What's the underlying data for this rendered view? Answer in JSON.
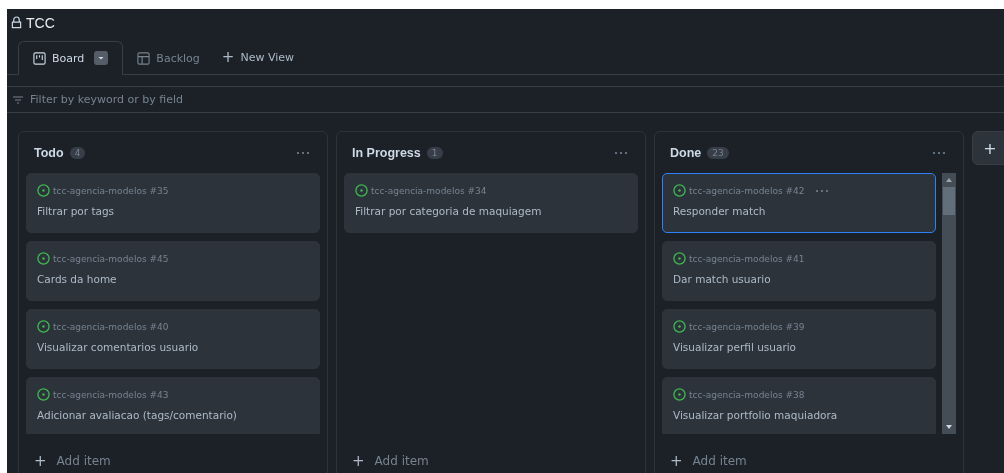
{
  "project": {
    "title": "TCC"
  },
  "views": [
    {
      "label": "Board",
      "kind": "board",
      "selected": true
    },
    {
      "label": "Backlog",
      "kind": "table",
      "selected": false
    }
  ],
  "new_view": {
    "label": "New View",
    "icon": "+"
  },
  "filter": {
    "placeholder": "Filter by keyword or by field"
  },
  "columns": [
    {
      "name": "Todo",
      "count": "4",
      "scrollable": false,
      "add_label": "Add item",
      "cards": [
        {
          "repo": "tcc-agencia-modelos #35",
          "title": "Filtrar por tags",
          "selected": false
        },
        {
          "repo": "tcc-agencia-modelos #45",
          "title": "Cards da home",
          "selected": false
        },
        {
          "repo": "tcc-agencia-modelos #40",
          "title": "Visualizar comentarios usuario",
          "selected": false
        },
        {
          "repo": "tcc-agencia-modelos #43",
          "title": "Adicionar avaliacao (tags/comentario)",
          "selected": false
        }
      ]
    },
    {
      "name": "In Progress",
      "count": "1",
      "scrollable": false,
      "add_label": "Add item",
      "cards": [
        {
          "repo": "tcc-agencia-modelos #34",
          "title": "Filtrar por categoria de maquiagem",
          "selected": false
        }
      ]
    },
    {
      "name": "Done",
      "count": "23",
      "scrollable": true,
      "add_label": "Add item",
      "cards": [
        {
          "repo": "tcc-agencia-modelos #42",
          "title": "Responder match",
          "selected": true
        },
        {
          "repo": "tcc-agencia-modelos #41",
          "title": "Dar match usuario",
          "selected": false
        },
        {
          "repo": "tcc-agencia-modelos #39",
          "title": "Visualizar perfil usuario",
          "selected": false
        },
        {
          "repo": "tcc-agencia-modelos #38",
          "title": "Visualizar portfolio maquiadora",
          "selected": false
        }
      ]
    }
  ],
  "add_column": {
    "icon": "+"
  }
}
